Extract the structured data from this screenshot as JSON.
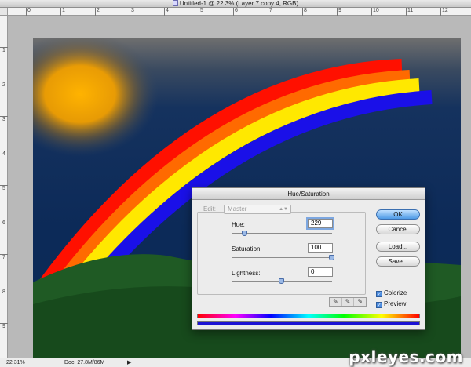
{
  "window": {
    "title": "Untitled-1 @ 22.3% (Layer 7 copy 4, RGB)"
  },
  "rulers": {
    "horizontal": [
      "0",
      "1",
      "2",
      "3",
      "4",
      "5",
      "6",
      "7",
      "8",
      "9",
      "10",
      "11",
      "12"
    ],
    "vertical": [
      "1",
      "2",
      "3",
      "4",
      "5",
      "6",
      "7",
      "8",
      "9"
    ]
  },
  "status": {
    "zoom": "22.31%",
    "doc": "Doc: 27.8M/86M"
  },
  "watermark": "pxleyes.com",
  "dialog": {
    "title": "Hue/Saturation",
    "edit_label": "Edit:",
    "edit_value": "Master",
    "hue_label": "Hue:",
    "hue_value": "229",
    "saturation_label": "Saturation:",
    "saturation_value": "100",
    "lightness_label": "Lightness:",
    "lightness_value": "0",
    "slider_levels": {
      "hue": 229,
      "hue_range": [
        -180,
        180
      ],
      "saturation": 100,
      "saturation_range": [
        0,
        100
      ],
      "lightness": 0,
      "lightness_range": [
        -100,
        100
      ]
    },
    "buttons": {
      "ok": "OK",
      "cancel": "Cancel",
      "load": "Load...",
      "save": "Save..."
    },
    "colorize_label": "Colorize",
    "colorize_checked": true,
    "preview_label": "Preview",
    "preview_checked": true
  },
  "colors": {
    "dialog_accent": "#4f8ee0",
    "colorized_bar": "#1c13d4",
    "sky": "#0c2a58"
  }
}
